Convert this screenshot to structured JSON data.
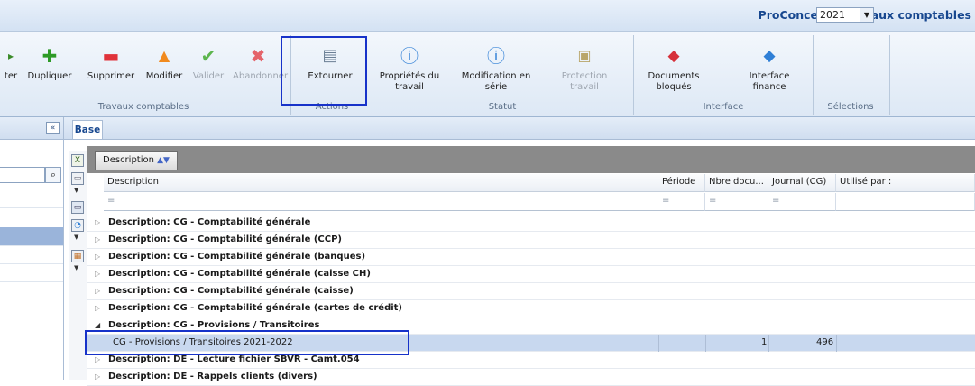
{
  "app": {
    "title": "ProConcept - Travaux comptables"
  },
  "ribbon": {
    "buttons": {
      "partial": "ter",
      "dupliquer": "Dupliquer",
      "supprimer": "Supprimer",
      "modifier": "Modifier",
      "valider": "Valider",
      "abandonner": "Abandonner",
      "extourner": "Extourner",
      "proprietes_line1": "Propriétés du",
      "proprietes_line2": "travail",
      "modification_line1": "Modification en",
      "modification_line2": "série",
      "protection_line1": "Protection",
      "protection_line2": "travail",
      "documents_line1": "Documents",
      "documents_line2": "bloqués",
      "interface_line1": "Interface",
      "interface_line2": "finance"
    },
    "groups": {
      "travaux": "Travaux comptables",
      "actions": "Actions",
      "statut": "Statut",
      "interface": "Interface",
      "selections": "Sélections"
    },
    "year_select": {
      "value": "2021"
    }
  },
  "tabs": {
    "active": "Base"
  },
  "grid": {
    "group_chip": "Description",
    "columns": [
      "Description",
      "Période",
      "Nbre docu...",
      "Journal (CG)",
      "Utilisé par :"
    ],
    "filter_symbol": "=",
    "group_rows": [
      "Description: CG - Comptabilité générale",
      "Description: CG - Comptabilité générale (CCP)",
      "Description: CG - Comptabilité générale (banques)",
      "Description: CG - Comptabilité générale (caisse CH)",
      "Description: CG - Comptabilité générale (caisse)",
      "Description: CG - Comptabilité générale (cartes de crédit)",
      "Description: CG - Provisions / Transitoires"
    ],
    "data_row": {
      "description": "CG - Provisions / Transitoires 2021-2022",
      "nbre": "1",
      "journal": "496"
    },
    "after_rows": [
      "Description: DE - Lecture fichier SBVR - Camt.054",
      "Description: DE - Rappels clients (divers)"
    ]
  },
  "colors": {
    "title": "#17478f",
    "highlight_box": "#1732c9",
    "group_bar": "#8a8a8a",
    "selected_row": "#c8d8ef"
  }
}
